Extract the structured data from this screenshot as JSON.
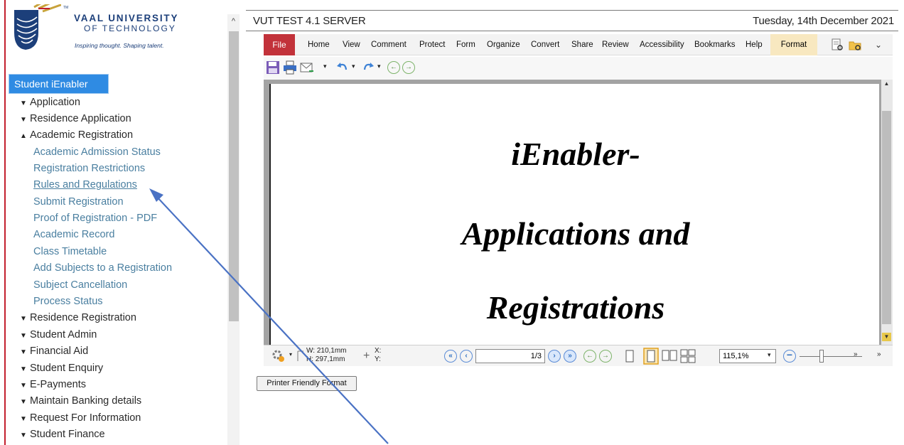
{
  "logo": {
    "line1": "VAAL UNIVERSITY",
    "line2": "OF TECHNOLOGY",
    "tagline": "Inspiring thought. Shaping talent.",
    "tm": "TM"
  },
  "sidebar": {
    "main_button": "Student iEnabler",
    "items_top": [
      {
        "label": "Application",
        "chevron": "⌄"
      },
      {
        "label": "Residence Application",
        "chevron": "⌄"
      },
      {
        "label": "Academic Registration",
        "chevron": "^"
      }
    ],
    "subitems": [
      "Academic Admission Status",
      "Registration Restrictions",
      "Rules and Regulations",
      "Submit Registration",
      "Proof of Registration - PDF",
      "Academic Record",
      "Class Timetable",
      "Add Subjects to a Registration",
      "Subject Cancellation",
      "Process Status"
    ],
    "items_bottom": [
      "Residence Registration",
      "Student Admin",
      "Financial Aid",
      "Student Enquiry",
      "E-Payments",
      "Maintain Banking details",
      "Request For Information",
      "Student Finance"
    ],
    "scroll_up": "^"
  },
  "header": {
    "title": "VUT TEST 4.1 SERVER",
    "date": "Tuesday, 14th December 2021"
  },
  "ribbon": {
    "file": "File",
    "tabs": [
      "Home",
      "View",
      "Comment",
      "Protect",
      "Form",
      "Organize",
      "Convert",
      "Share",
      "Review",
      "Accessibility",
      "Bookmarks",
      "Help"
    ],
    "format": "Format",
    "chevron": "⌄"
  },
  "document": {
    "line1": "iEnabler-",
    "line2": "Applications and",
    "line3": "Registrations"
  },
  "statusbar": {
    "width": "W: 210,1mm",
    "height": "H: 297,1mm",
    "x": "X:",
    "y": "Y:",
    "page": "1/3",
    "zoom": "115,1%"
  },
  "printer_button": "Printer Friendly Format",
  "colors": {
    "accent_blue": "#2f8be3",
    "file_red": "#c2323a",
    "link_blue": "#4a7fa0",
    "brand_navy": "#1c3f7a",
    "arrow": "#4a72c4"
  }
}
